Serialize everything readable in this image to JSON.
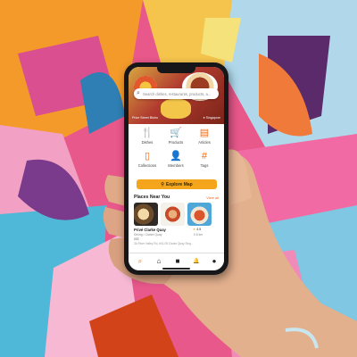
{
  "app": {
    "search": {
      "placeholder": "Search dishes, restaurants, products, a..."
    },
    "hero": {
      "left_caption": "Price Street Bistro",
      "right_caption": "● Singapore"
    },
    "categories": [
      {
        "label": "Dishes",
        "icon": "fork-knife-icon",
        "glyph": "🍴"
      },
      {
        "label": "Products",
        "icon": "cart-icon",
        "glyph": "🛒"
      },
      {
        "label": "Articles",
        "icon": "article-icon",
        "glyph": "▤"
      },
      {
        "label": "Collections",
        "icon": "bookmark-icon",
        "glyph": "▯"
      },
      {
        "label": "Members",
        "icon": "person-icon",
        "glyph": "👤"
      },
      {
        "label": "Tags",
        "icon": "hashtag-icon",
        "glyph": "#"
      }
    ],
    "explore_button": {
      "label": "Explore Map",
      "icon": "map-pin-icon"
    },
    "places": {
      "title": "Places Near You",
      "view_all": "View all",
      "item": {
        "name": "Privé Clarke Quay",
        "rating": "4.5",
        "category": "Dining • Clarke Quay",
        "price": "$$$",
        "distance": "0.6 km",
        "address": "3A River Valley Rd, #01-09 Clarke Quay Sing..."
      }
    },
    "tabs": [
      {
        "name": "search",
        "icon": "search-icon",
        "glyph": "⌕",
        "active": true
      },
      {
        "name": "home",
        "icon": "home-icon",
        "glyph": "⌂",
        "active": false
      },
      {
        "name": "feed",
        "icon": "feed-icon",
        "glyph": "■",
        "active": false
      },
      {
        "name": "notifications",
        "icon": "bell-icon",
        "glyph": "🔔",
        "active": false
      },
      {
        "name": "profile",
        "icon": "profile-icon",
        "glyph": "●",
        "active": false
      }
    ]
  },
  "colors": {
    "accent": "#f36a10",
    "button": "#f5a51c",
    "phone": "#17171a"
  }
}
